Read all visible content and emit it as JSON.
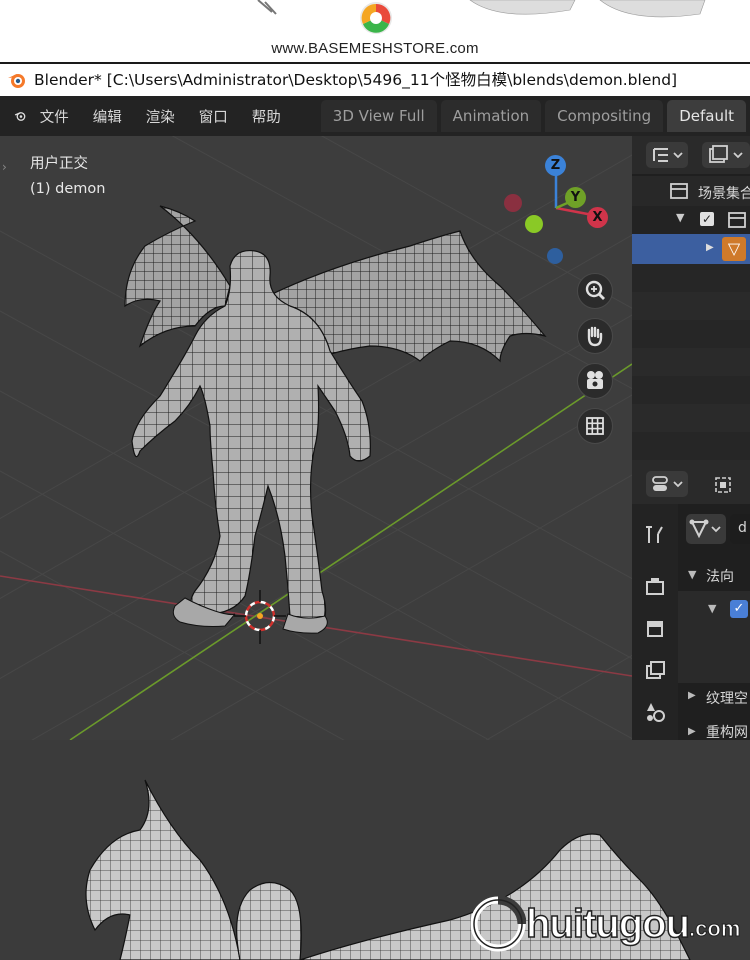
{
  "banner": {
    "site_url": "www.BASEMESHSTORE.com"
  },
  "window": {
    "title": "Blender* [C:\\Users\\Administrator\\Desktop\\5496_11个怪物白模\\blends\\demon.blend]"
  },
  "menubar": {
    "items": [
      "文件",
      "编辑",
      "渲染",
      "窗口",
      "帮助"
    ],
    "workspace_tabs": [
      "3D View Full",
      "Animation",
      "Compositing",
      "Default"
    ],
    "active_tab": "Default"
  },
  "viewport": {
    "view_name": "用户正交",
    "object_label": "(1) demon",
    "gizmo": {
      "z": "Z",
      "y": "Y",
      "x": "X"
    },
    "colors": {
      "x_axis": "#a23a44",
      "y_axis": "#6b9a2b",
      "grid": "#4a4a4a",
      "mesh_fill": "#9a9a9a",
      "mesh_wire": "#1c1c1c"
    },
    "nav_icons": [
      "zoom-icon",
      "hand-icon",
      "camera-icon",
      "grid-icon"
    ]
  },
  "outliner": {
    "scene_collection": "场景集合",
    "selected_row_color": "#3c5fa0"
  },
  "properties": {
    "section_normals": "法向",
    "section_texture": "纹理空",
    "section_remesh": "重构网",
    "object_field": "d"
  },
  "watermark": {
    "brand_text": "huitugou",
    "suffix": ".com"
  }
}
